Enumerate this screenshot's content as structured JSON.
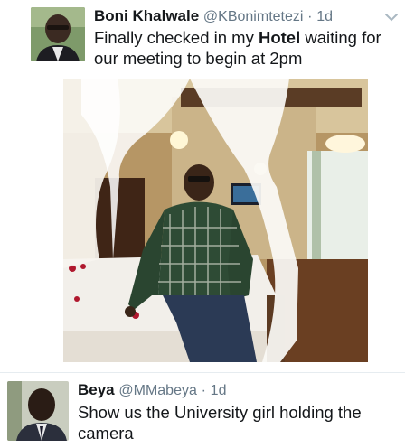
{
  "tweets": [
    {
      "name": "Boni Khalwale",
      "handle": "@KBonimtetezi",
      "separator": "·",
      "time": "1d",
      "text_before": "Finally checked in my ",
      "text_bold": "Hotel",
      "text_after": " waiting for our meeting to begin at 2pm",
      "media": "photo of a man seated on a canopy bed in a hotel room",
      "avatar_icon": "profile-photo"
    },
    {
      "name": "Beya",
      "handle": "@MMabeya",
      "separator": "·",
      "time": "1d",
      "text": "Show us the University girl holding the camera",
      "avatar_icon": "profile-photo"
    }
  ],
  "icons": {
    "more": "chevron-down-icon"
  },
  "colors": {
    "text": "#14171a",
    "secondary": "#657786",
    "divider": "#e6ecf0"
  }
}
